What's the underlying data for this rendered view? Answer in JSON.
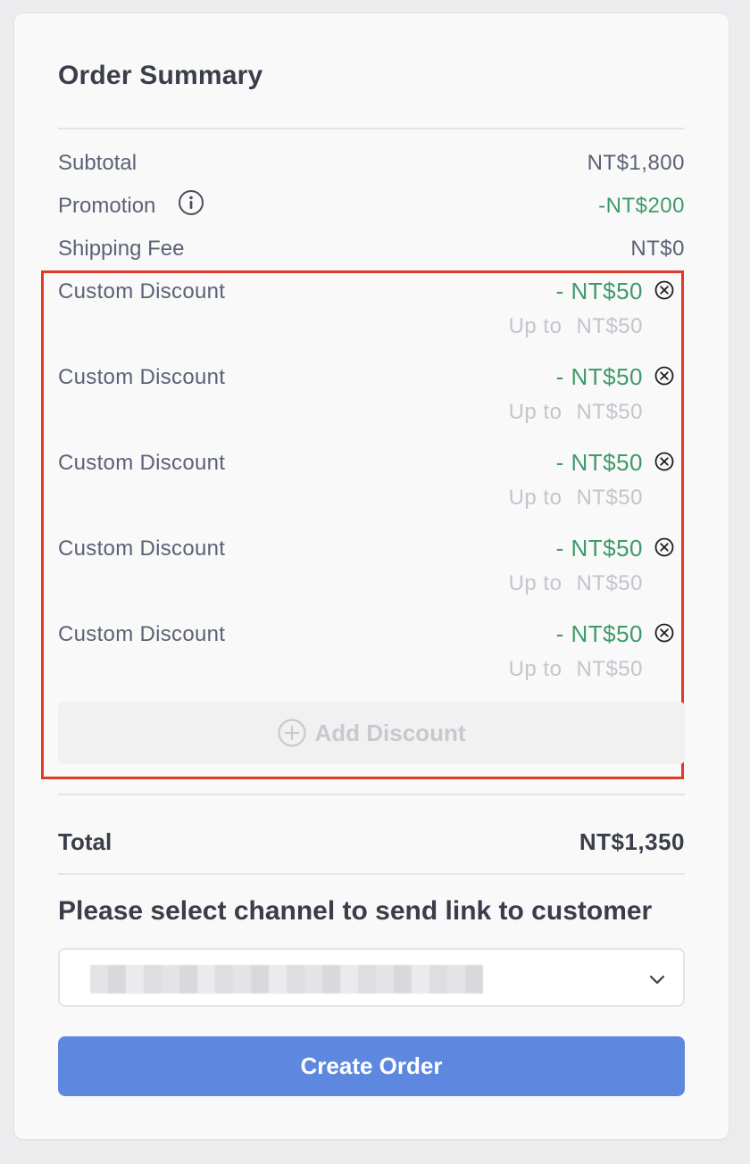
{
  "summary": {
    "title": "Order Summary",
    "subtotal_label": "Subtotal",
    "subtotal_value": "NT$1,800",
    "promotion_label": "Promotion",
    "promotion_value": "-NT$200",
    "shipping_label": "Shipping Fee",
    "shipping_value": "NT$0"
  },
  "discounts": [
    {
      "label": "Custom Discount",
      "amount": "- NT$50",
      "limit_prefix": "Up to",
      "limit_value": "NT$50"
    },
    {
      "label": "Custom Discount",
      "amount": "- NT$50",
      "limit_prefix": "Up to",
      "limit_value": "NT$50"
    },
    {
      "label": "Custom Discount",
      "amount": "- NT$50",
      "limit_prefix": "Up to",
      "limit_value": "NT$50"
    },
    {
      "label": "Custom Discount",
      "amount": "- NT$50",
      "limit_prefix": "Up to",
      "limit_value": "NT$50"
    },
    {
      "label": "Custom Discount",
      "amount": "- NT$50",
      "limit_prefix": "Up to",
      "limit_value": "NT$50"
    }
  ],
  "add_discount_label": "Add Discount",
  "total": {
    "label": "Total",
    "value": "NT$1,350"
  },
  "channel": {
    "title": "Please select channel to send link to customer",
    "selected_value": ""
  },
  "create_button_label": "Create Order",
  "colors": {
    "accent": "#5e88e0",
    "discount_green": "#3f9a6a",
    "highlight_border": "#e03a26"
  },
  "icons": {
    "info": "info-icon",
    "remove": "close-circle-icon",
    "add": "plus-circle-icon",
    "dropdown": "chevron-down-icon"
  }
}
